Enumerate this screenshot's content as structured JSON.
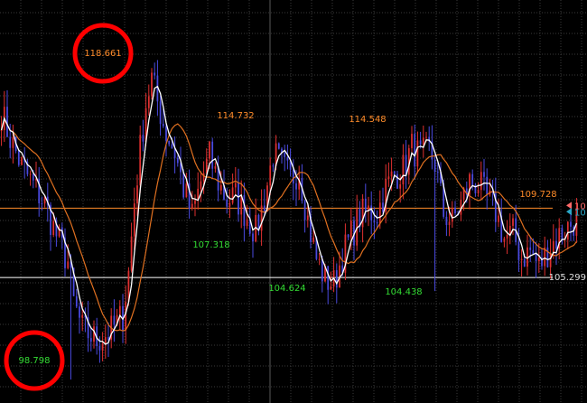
{
  "chart_data": {
    "type": "candlestick",
    "title": "",
    "xlabel": "",
    "ylabel": "",
    "ylim": [
      97.3,
      123.0
    ],
    "grid": true,
    "colors": {
      "background": "#000000",
      "grid": "#3a3a3a",
      "bullish": "#e03030",
      "bearish": "#4a4ae0",
      "ma_fast": "#ffffff",
      "ma_slow": "#e07020",
      "label_high": "#ff8c2a",
      "label_low": "#33dd33",
      "highlight_circle": "#ff0000",
      "h_line_orange": "#ff8c2a",
      "h_line_white": "#ffffff",
      "price_tag_orange": "#ff6a6a",
      "price_tag_cyan": "#2aa8c8"
    },
    "horizontal_lines": [
      {
        "value": 109.728,
        "color": "orange"
      },
      {
        "value": 105.299,
        "color": "white"
      }
    ],
    "axis_labels": [
      {
        "value": 105.299,
        "text": "105.299"
      }
    ],
    "price_tags": [
      {
        "value": 109.9,
        "text": "10",
        "color": "orange"
      },
      {
        "value": 109.5,
        "text": "10",
        "color": "cyan"
      }
    ],
    "annotations": [
      {
        "text": "118.661",
        "value": 118.661,
        "kind": "high",
        "circled": true
      },
      {
        "text": "114.732",
        "value": 114.732,
        "kind": "high",
        "circled": false
      },
      {
        "text": "114.548",
        "value": 114.548,
        "kind": "high",
        "circled": false
      },
      {
        "text": "109.728",
        "value": 109.728,
        "kind": "high",
        "circled": false
      },
      {
        "text": "107.318",
        "value": 107.318,
        "kind": "low",
        "circled": false
      },
      {
        "text": "104.624",
        "value": 104.624,
        "kind": "low",
        "circled": false
      },
      {
        "text": "104.438",
        "value": 104.438,
        "kind": "low",
        "circled": false
      },
      {
        "text": "98.798",
        "value": 98.798,
        "kind": "low",
        "circled": true
      }
    ],
    "close_path": [
      [
        0,
        115.8
      ],
      [
        3,
        114.2
      ],
      [
        7,
        112.4
      ],
      [
        11,
        111.2
      ],
      [
        15,
        110.0
      ],
      [
        19,
        108.0
      ],
      [
        23,
        106.3
      ],
      [
        25,
        103.7
      ],
      [
        28,
        102.0
      ],
      [
        33,
        101.3
      ],
      [
        38,
        101.9
      ],
      [
        42,
        102.9
      ],
      [
        44,
        105.6
      ],
      [
        46,
        110.2
      ],
      [
        48,
        113.5
      ],
      [
        50,
        116.4
      ],
      [
        52,
        118.0
      ],
      [
        54,
        116.5
      ],
      [
        57,
        114.5
      ],
      [
        60,
        113.3
      ],
      [
        63,
        111.0
      ],
      [
        66,
        109.2
      ],
      [
        69,
        111.4
      ],
      [
        72,
        113.0
      ],
      [
        75,
        111.4
      ],
      [
        78,
        110.2
      ],
      [
        81,
        110.5
      ],
      [
        85,
        109.2
      ],
      [
        88,
        108.2
      ],
      [
        91,
        110.3
      ],
      [
        94,
        113.2
      ],
      [
        97,
        112.4
      ],
      [
        100,
        111.6
      ],
      [
        103,
        112.2
      ],
      [
        106,
        109.0
      ],
      [
        109,
        106.5
      ],
      [
        112,
        105.2
      ],
      [
        115,
        104.9
      ],
      [
        118,
        106.7
      ],
      [
        121,
        108.0
      ],
      [
        124,
        109.2
      ],
      [
        127,
        109.5
      ],
      [
        130,
        109.4
      ],
      [
        133,
        111.0
      ],
      [
        136,
        111.9
      ],
      [
        139,
        112.2
      ],
      [
        142,
        113.6
      ],
      [
        145,
        113.0
      ],
      [
        148,
        113.4
      ],
      [
        150,
        112.6
      ],
      [
        153,
        109.4
      ],
      [
        156,
        108.9
      ],
      [
        159,
        110.0
      ],
      [
        162,
        111.4
      ],
      [
        165,
        111.3
      ],
      [
        168,
        110.3
      ],
      [
        171,
        109.5
      ],
      [
        174,
        107.8
      ],
      [
        177,
        108.1
      ],
      [
        180,
        106.6
      ],
      [
        183,
        107.0
      ],
      [
        186,
        106.0
      ],
      [
        189,
        107.0
      ],
      [
        192,
        107.8
      ],
      [
        195,
        108.3
      ],
      [
        199,
        109.1
      ]
    ]
  }
}
